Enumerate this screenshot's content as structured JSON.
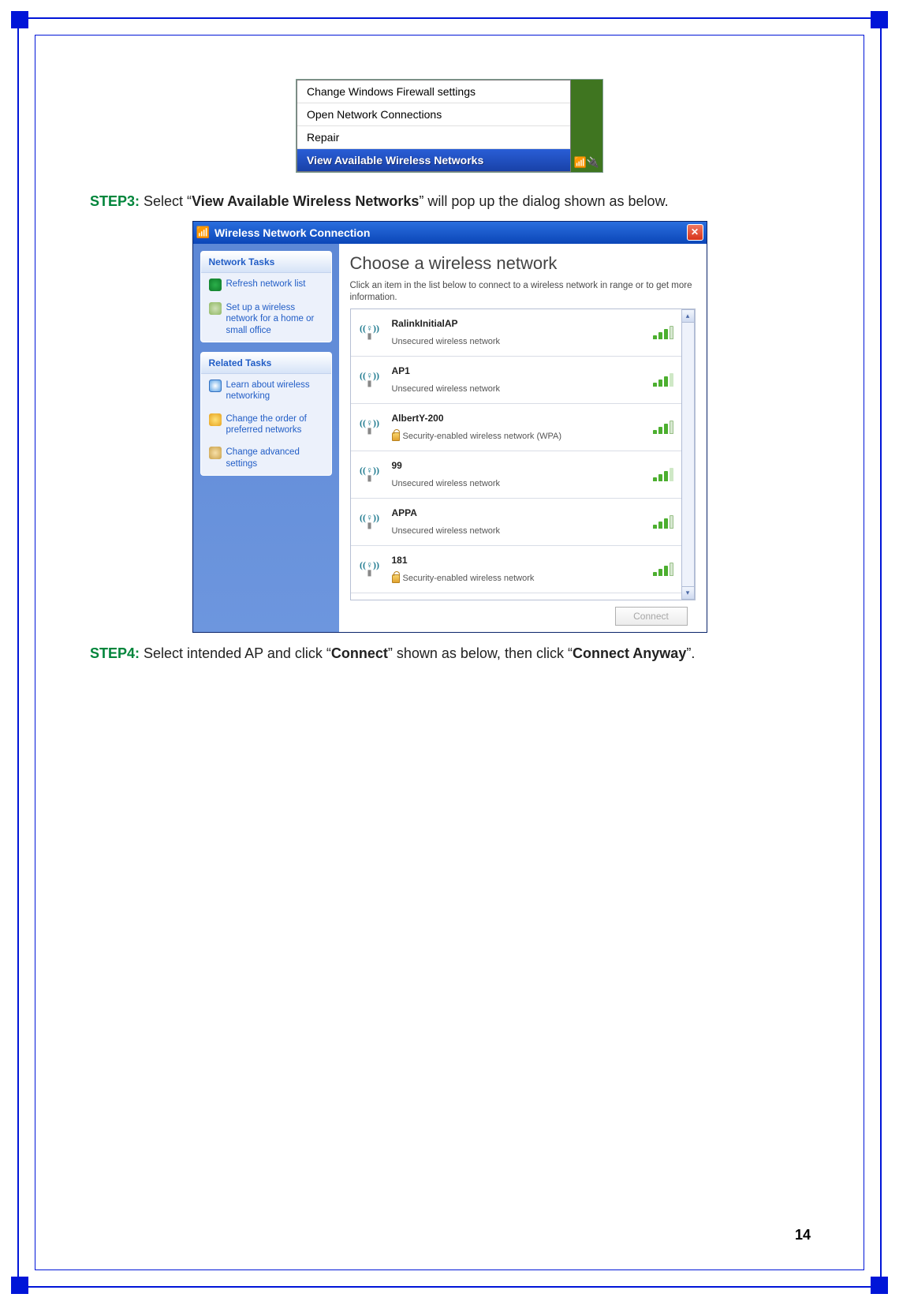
{
  "context_menu": {
    "items": [
      "Change Windows Firewall settings",
      "Open Network Connections",
      "Repair",
      "View Available Wireless Networks"
    ]
  },
  "step3": {
    "label": "STEP3:",
    "pre": " Select “",
    "bold": "View Available Wireless Networks",
    "post": "” will pop up the dialog shown as below."
  },
  "step4": {
    "label": "STEP4:",
    "pre": " Select intended AP and click “",
    "bold1": "Connect",
    "mid": "” shown as below, then click “",
    "bold2": "Connect Anyway",
    "post": "”."
  },
  "dialog": {
    "title": "Wireless Network Connection",
    "sidebar": {
      "tasks_head": "Network Tasks",
      "refresh": "Refresh network list",
      "setup": "Set up a wireless network for a home or small office",
      "related_head": "Related Tasks",
      "learn": "Learn about wireless networking",
      "order": "Change the order of preferred networks",
      "advanced": "Change advanced settings"
    },
    "main_title": "Choose a wireless network",
    "main_sub": "Click an item in the list below to connect to a wireless network in range or to get more information.",
    "networks": [
      {
        "name": "RalinkInitialAP",
        "desc": "Unsecured wireless network",
        "secured": false,
        "bars": 3
      },
      {
        "name": "AP1",
        "desc": "Unsecured wireless network",
        "secured": false,
        "bars": 4
      },
      {
        "name": "AlbertY-200",
        "desc": "Security-enabled wireless network (WPA)",
        "secured": true,
        "bars": 3
      },
      {
        "name": "99",
        "desc": "Unsecured wireless network",
        "secured": false,
        "bars": 4
      },
      {
        "name": "APPA",
        "desc": "Unsecured wireless network",
        "secured": false,
        "bars": 3
      },
      {
        "name": "181",
        "desc": "Security-enabled wireless network",
        "secured": true,
        "bars": 3
      }
    ],
    "connect": "Connect"
  },
  "page_number": "14"
}
